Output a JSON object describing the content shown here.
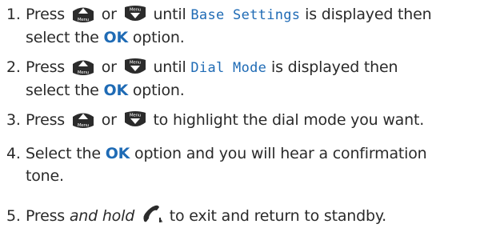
{
  "steps": [
    {
      "num": "1.",
      "pre": "Press",
      "or": "or",
      "post": "until",
      "lcd": "Base Settings",
      "post2": "is displayed then",
      "line2_pre": "select the",
      "ok": "OK",
      "line2_post": "option."
    },
    {
      "num": "2.",
      "pre": "Press",
      "or": "or",
      "post": "until",
      "lcd": "Dial Mode",
      "post2": "is displayed then",
      "line2_pre": "select the",
      "ok": "OK",
      "line2_post": "option."
    },
    {
      "num": "3.",
      "pre": "Press",
      "or": "or",
      "post": "to highlight the dial mode you want."
    },
    {
      "num": "4.",
      "pre": "Select the",
      "ok": "OK",
      "post": "option and you will hear a confirmation",
      "line2": "tone."
    },
    {
      "num": "5.",
      "pre": "Press",
      "italic": "and hold",
      "post": "to exit and return to standby."
    }
  ],
  "icons": {
    "up_button": "up-arrow-button-icon",
    "menu_button": "menu-down-button-icon",
    "end_call": "end-call-handset-icon",
    "button_label": "Menu",
    "button_color": "#2b2b2b",
    "text_accent": "#1f6bb5"
  }
}
